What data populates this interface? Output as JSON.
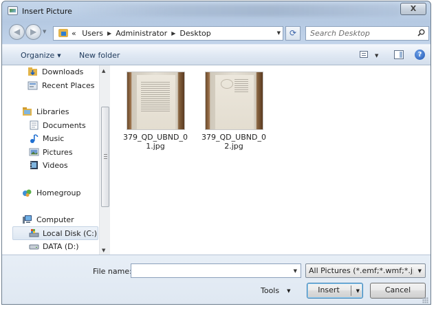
{
  "window": {
    "title": "Insert Picture",
    "close_label": "X"
  },
  "address": {
    "overflow": "«",
    "crumbs": [
      "Users",
      "Administrator",
      "Desktop"
    ]
  },
  "search": {
    "placeholder": "Search Desktop"
  },
  "toolbar": {
    "organize_label": "Organize",
    "new_folder_label": "New folder",
    "help_label": "?"
  },
  "nav": {
    "items": [
      {
        "label": "Downloads",
        "icon": "downloads-icon"
      },
      {
        "label": "Recent Places",
        "icon": "recent-places-icon"
      },
      {
        "label": "Libraries",
        "icon": "libraries-icon"
      },
      {
        "label": "Documents",
        "icon": "documents-icon"
      },
      {
        "label": "Music",
        "icon": "music-icon"
      },
      {
        "label": "Pictures",
        "icon": "pictures-icon"
      },
      {
        "label": "Videos",
        "icon": "videos-icon"
      },
      {
        "label": "Homegroup",
        "icon": "homegroup-icon"
      },
      {
        "label": "Computer",
        "icon": "computer-icon"
      },
      {
        "label": "Local Disk (C:)",
        "icon": "local-disk-icon",
        "selected": true
      },
      {
        "label": "DATA (D:)",
        "icon": "drive-icon"
      }
    ]
  },
  "files": [
    {
      "name": "379_QD_UBND_01.jpg",
      "name_lines": [
        "379_QD_UBND_0",
        "1.jpg"
      ]
    },
    {
      "name": "379_QD_UBND_02.jpg",
      "name_lines": [
        "379_QD_UBND_0",
        "2.jpg"
      ]
    }
  ],
  "bottom": {
    "file_name_label": "File name:",
    "file_name_value": "",
    "file_type_value": "All Pictures (*.emf;*.wmf;*.jpg;*",
    "tools_label": "Tools",
    "insert_label": "Insert",
    "cancel_label": "Cancel"
  },
  "colors": {
    "frame": "#c2d4ea",
    "toolbar_text": "#1e395b",
    "insert_border": "#3c7fb1"
  }
}
